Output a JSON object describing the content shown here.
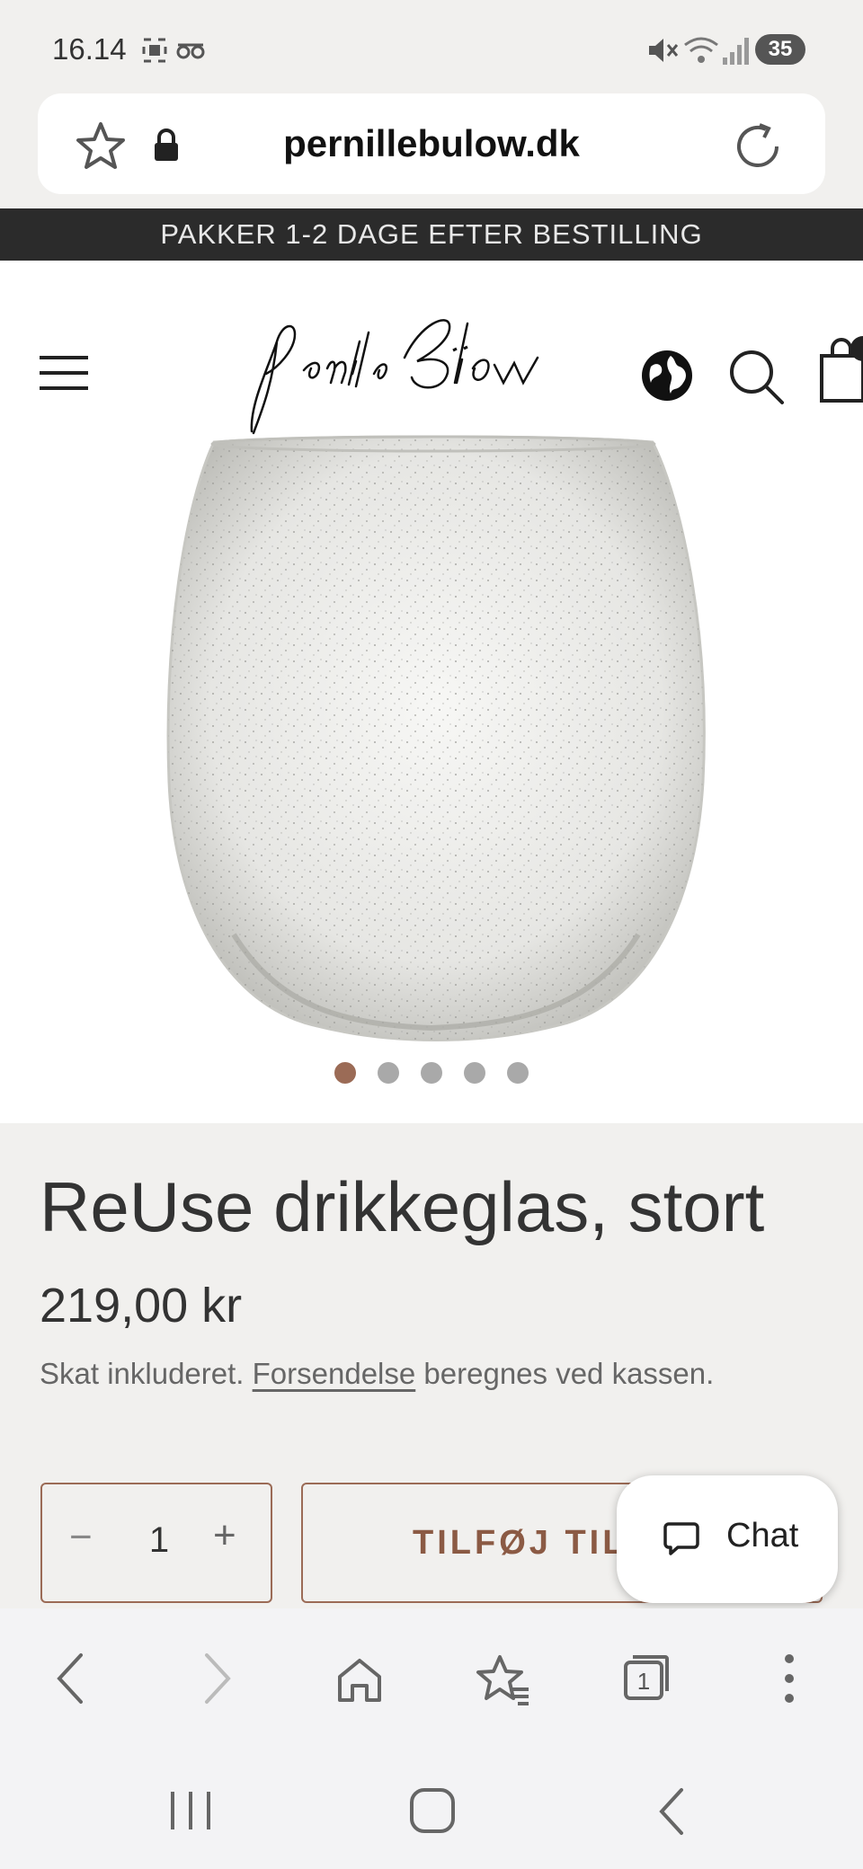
{
  "status_bar": {
    "time": "16.14",
    "battery": "35"
  },
  "browser": {
    "url": "pernillebulow.dk",
    "tab_count": "1"
  },
  "announcement": "PAKKER 1-2 DAGE EFTER BESTILLING",
  "site": {
    "logo_text": "Pernille Bülow"
  },
  "carousel": {
    "total": 5,
    "active_index": 0
  },
  "product": {
    "title": "ReUse drikkeglas, stort",
    "price": "219,00 kr",
    "tax_prefix": "Skat inkluderet.",
    "tax_link": "Forsendelse",
    "tax_suffix": "beregnes ved kassen.",
    "quantity": "1",
    "add_to_cart": "TILFØJ TIL KURV"
  },
  "chat": {
    "label": "Chat"
  },
  "colors": {
    "accent": "#9b6b56",
    "dot_active": "#9b6b56",
    "dot_inactive": "#a9a9a9",
    "announce_bg": "#2b2b2b"
  }
}
